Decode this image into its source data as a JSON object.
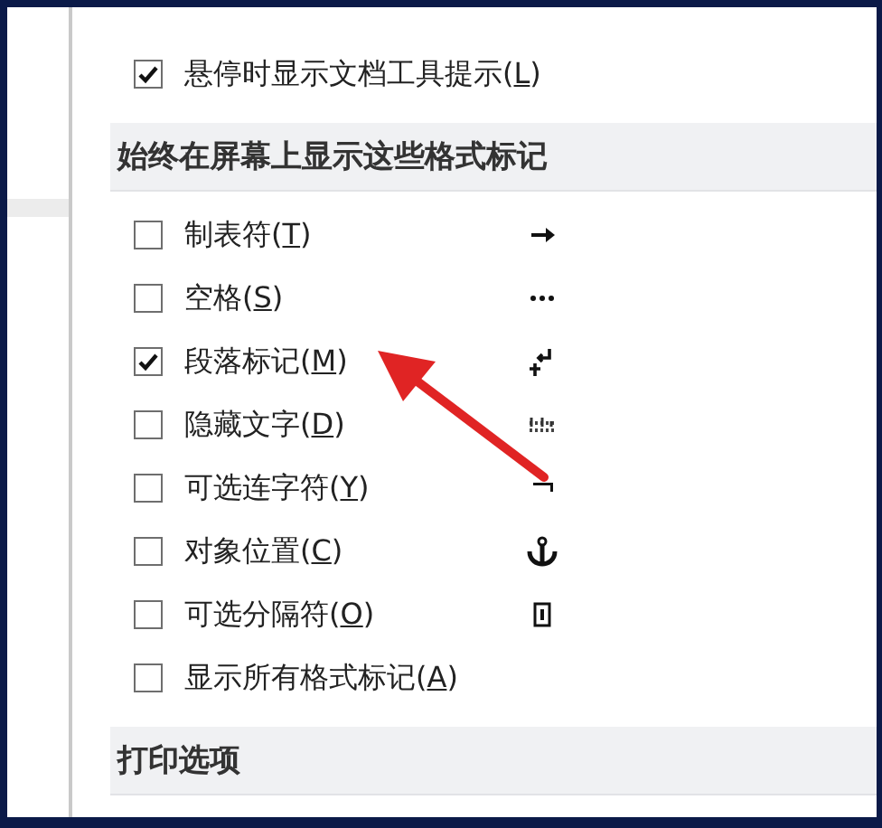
{
  "top_options": [
    {
      "before": "悬停时显示文档工具提示(",
      "key": "L",
      "after": ")",
      "checked": true
    }
  ],
  "sections": [
    {
      "title": "始终在屏幕上显示这些格式标记",
      "options": [
        {
          "before": "制表符(",
          "key": "T",
          "after": ")",
          "checked": false,
          "kind": "tab"
        },
        {
          "before": "空格(",
          "key": "S",
          "after": ")",
          "checked": false,
          "kind": "space"
        },
        {
          "before": "段落标记(",
          "key": "M",
          "after": ")",
          "checked": true,
          "kind": "paragraph"
        },
        {
          "before": "隐藏文字(",
          "key": "D",
          "after": ")",
          "checked": false,
          "kind": "hidden"
        },
        {
          "before": "可选连字符(",
          "key": "Y",
          "after": ")",
          "checked": false,
          "kind": "hyphen"
        },
        {
          "before": "对象位置(",
          "key": "C",
          "after": ")",
          "checked": false,
          "kind": "anchor"
        },
        {
          "before": "可选分隔符(",
          "key": "O",
          "after": ")",
          "checked": false,
          "kind": "break"
        },
        {
          "before": "显示所有格式标记(",
          "key": "A",
          "after": ")",
          "checked": false
        }
      ]
    },
    {
      "title": "打印选项"
    }
  ]
}
